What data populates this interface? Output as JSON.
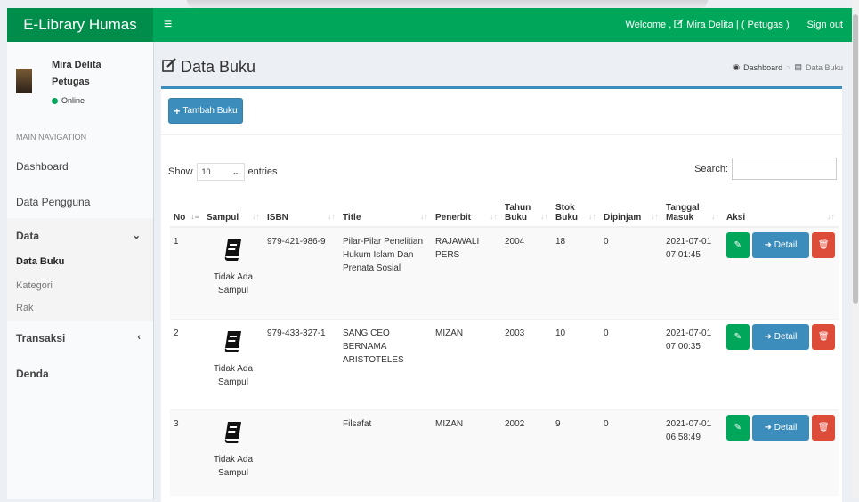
{
  "app": {
    "logo": "E-Library Humas",
    "welcome": "Welcome , ",
    "welcome_user": "Mira Delita | ( Petugas )",
    "signout": "Sign out"
  },
  "user": {
    "name": "Mira Delita",
    "role": "Petugas",
    "status": "Online"
  },
  "nav": {
    "header": "MAIN NAVIGATION",
    "items": [
      "Dashboard",
      "Data Pengguna",
      "Data",
      "Transaksi",
      "Denda"
    ],
    "data_sub": [
      "Data Buku",
      "Kategori",
      "Rak"
    ],
    "chev_down": "⌄",
    "chev_left": "‹"
  },
  "page": {
    "title": "Data Buku",
    "breadcrumb": [
      "Dashboard",
      "Data Buku"
    ]
  },
  "toolbar": {
    "add_label": "Tambah Buku"
  },
  "table_controls": {
    "show": "Show",
    "entries_value": "10",
    "entries": "entries",
    "search": "Search:"
  },
  "table": {
    "headers": [
      "No",
      "Sampul",
      "ISBN",
      "Title",
      "Penerbit",
      "Tahun Buku",
      "Stok Buku",
      "Dipinjam",
      "Tanggal Masuk",
      "Aksi"
    ],
    "rows": [
      {
        "no": "1",
        "cover": "Tidak Ada Sampul",
        "isbn": "979-421-986-9",
        "title": "Pilar-Pilar Penelitian Hukum Islam Dan Prenata Sosial",
        "penerbit": "RAJAWALI PERS",
        "tahun": "2004",
        "stok": "18",
        "dipinjam": "0",
        "tanggal": "2021-07-01 07:01:45"
      },
      {
        "no": "2",
        "cover": "Tidak Ada Sampul",
        "isbn": "979-433-327-1",
        "title": "SANG CEO BERNAMA ARISTOTELES",
        "penerbit": "MIZAN",
        "tahun": "2003",
        "stok": "10",
        "dipinjam": "0",
        "tanggal": "2021-07-01 07:00:35"
      },
      {
        "no": "3",
        "cover": "Tidak Ada Sampul",
        "isbn": "",
        "title": "Filsafat",
        "penerbit": "MIZAN",
        "tahun": "2002",
        "stok": "9",
        "dipinjam": "0",
        "tanggal": "2021-07-01 06:58:49"
      }
    ],
    "detail_label": "Detail"
  },
  "colors": {
    "topbar": "#00a65a",
    "primary": "#3c8dbc",
    "danger": "#dd4b39",
    "success": "#00a65a"
  }
}
